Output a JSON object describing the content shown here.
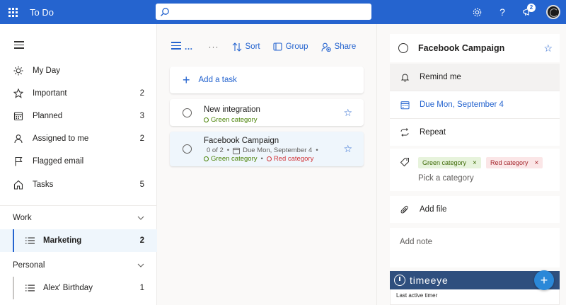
{
  "topbar": {
    "app_title": "To Do",
    "search_placeholder": "",
    "notification_count": "2",
    "help_label": "?"
  },
  "sidebar": {
    "nav_items": [
      {
        "label": "My Day",
        "count": ""
      },
      {
        "label": "Important",
        "count": "2"
      },
      {
        "label": "Planned",
        "count": "3"
      },
      {
        "label": "Assigned to me",
        "count": "2"
      },
      {
        "label": "Flagged email",
        "count": ""
      },
      {
        "label": "Tasks",
        "count": "5"
      }
    ],
    "groups": [
      {
        "label": "Work",
        "lists": [
          {
            "label": "Marketing",
            "count": "2"
          }
        ]
      },
      {
        "label": "Personal",
        "lists": [
          {
            "label": "Alex' Birthday",
            "count": "1"
          }
        ]
      }
    ]
  },
  "toolbar": {
    "list_dots": "...",
    "more": "···",
    "sort_label": "Sort",
    "group_label": "Group",
    "share_label": "Share"
  },
  "tasks": {
    "add_label": "Add a task",
    "items": [
      {
        "title": "New integration",
        "category": "Green category"
      },
      {
        "title": "Facebook Campaign",
        "steps": "0 of 2",
        "due": "Due Mon, September 4",
        "category_green": "Green category",
        "category_red": "Red category"
      }
    ]
  },
  "detail": {
    "title": "Facebook Campaign",
    "remind": "Remind me",
    "due": "Due Mon, September 4",
    "repeat": "Repeat",
    "chip_green": "Green category",
    "chip_red": "Red category",
    "chip_remove": "×",
    "pick_category": "Pick a category",
    "add_file": "Add file",
    "add_note": "Add note",
    "timeeye_name": "timeeye",
    "timeeye_sub": "Last active timer",
    "timeeye_plus": "+"
  },
  "colors": {
    "accent": "#2564cf",
    "green": "#498205",
    "red": "#d13438"
  }
}
